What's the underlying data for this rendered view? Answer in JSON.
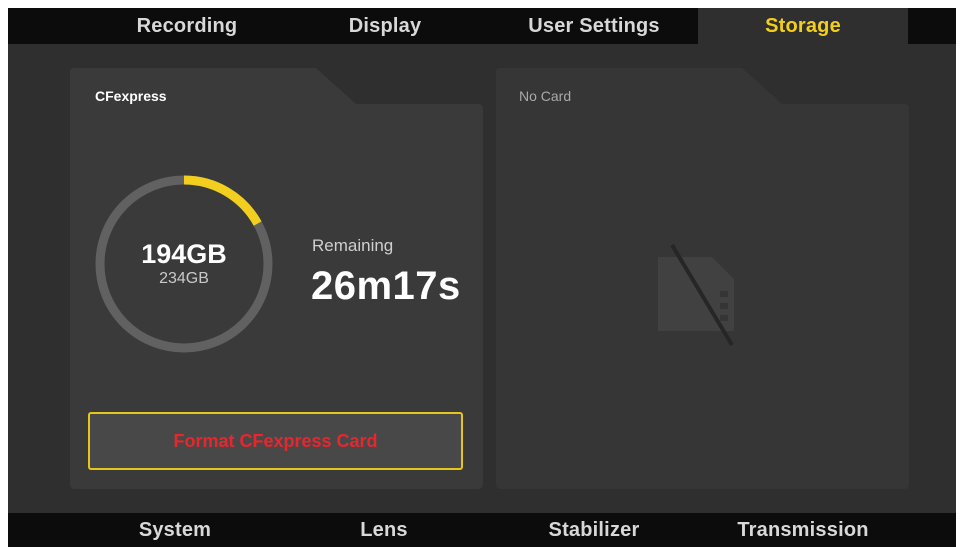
{
  "top_tabs": [
    {
      "label": "Recording"
    },
    {
      "label": "Display"
    },
    {
      "label": "User Settings"
    },
    {
      "label": "Storage",
      "active": true
    }
  ],
  "bottom_tabs": [
    {
      "label": "System"
    },
    {
      "label": "Lens"
    },
    {
      "label": "Stabilizer"
    },
    {
      "label": "Transmission"
    }
  ],
  "card_slot_1": {
    "label": "CFexpress",
    "used": "194GB",
    "total": "234GB",
    "used_fraction": 0.17,
    "remaining_label": "Remaining",
    "remaining_time": "26m17s",
    "format_button": "Format CFexpress Card"
  },
  "card_slot_2": {
    "label": "No Card",
    "icon": "no-card-icon"
  },
  "colors": {
    "accent": "#f2cf1e",
    "danger": "#e8262d",
    "ring_track": "#616161",
    "panel": "#3a3a3a"
  }
}
